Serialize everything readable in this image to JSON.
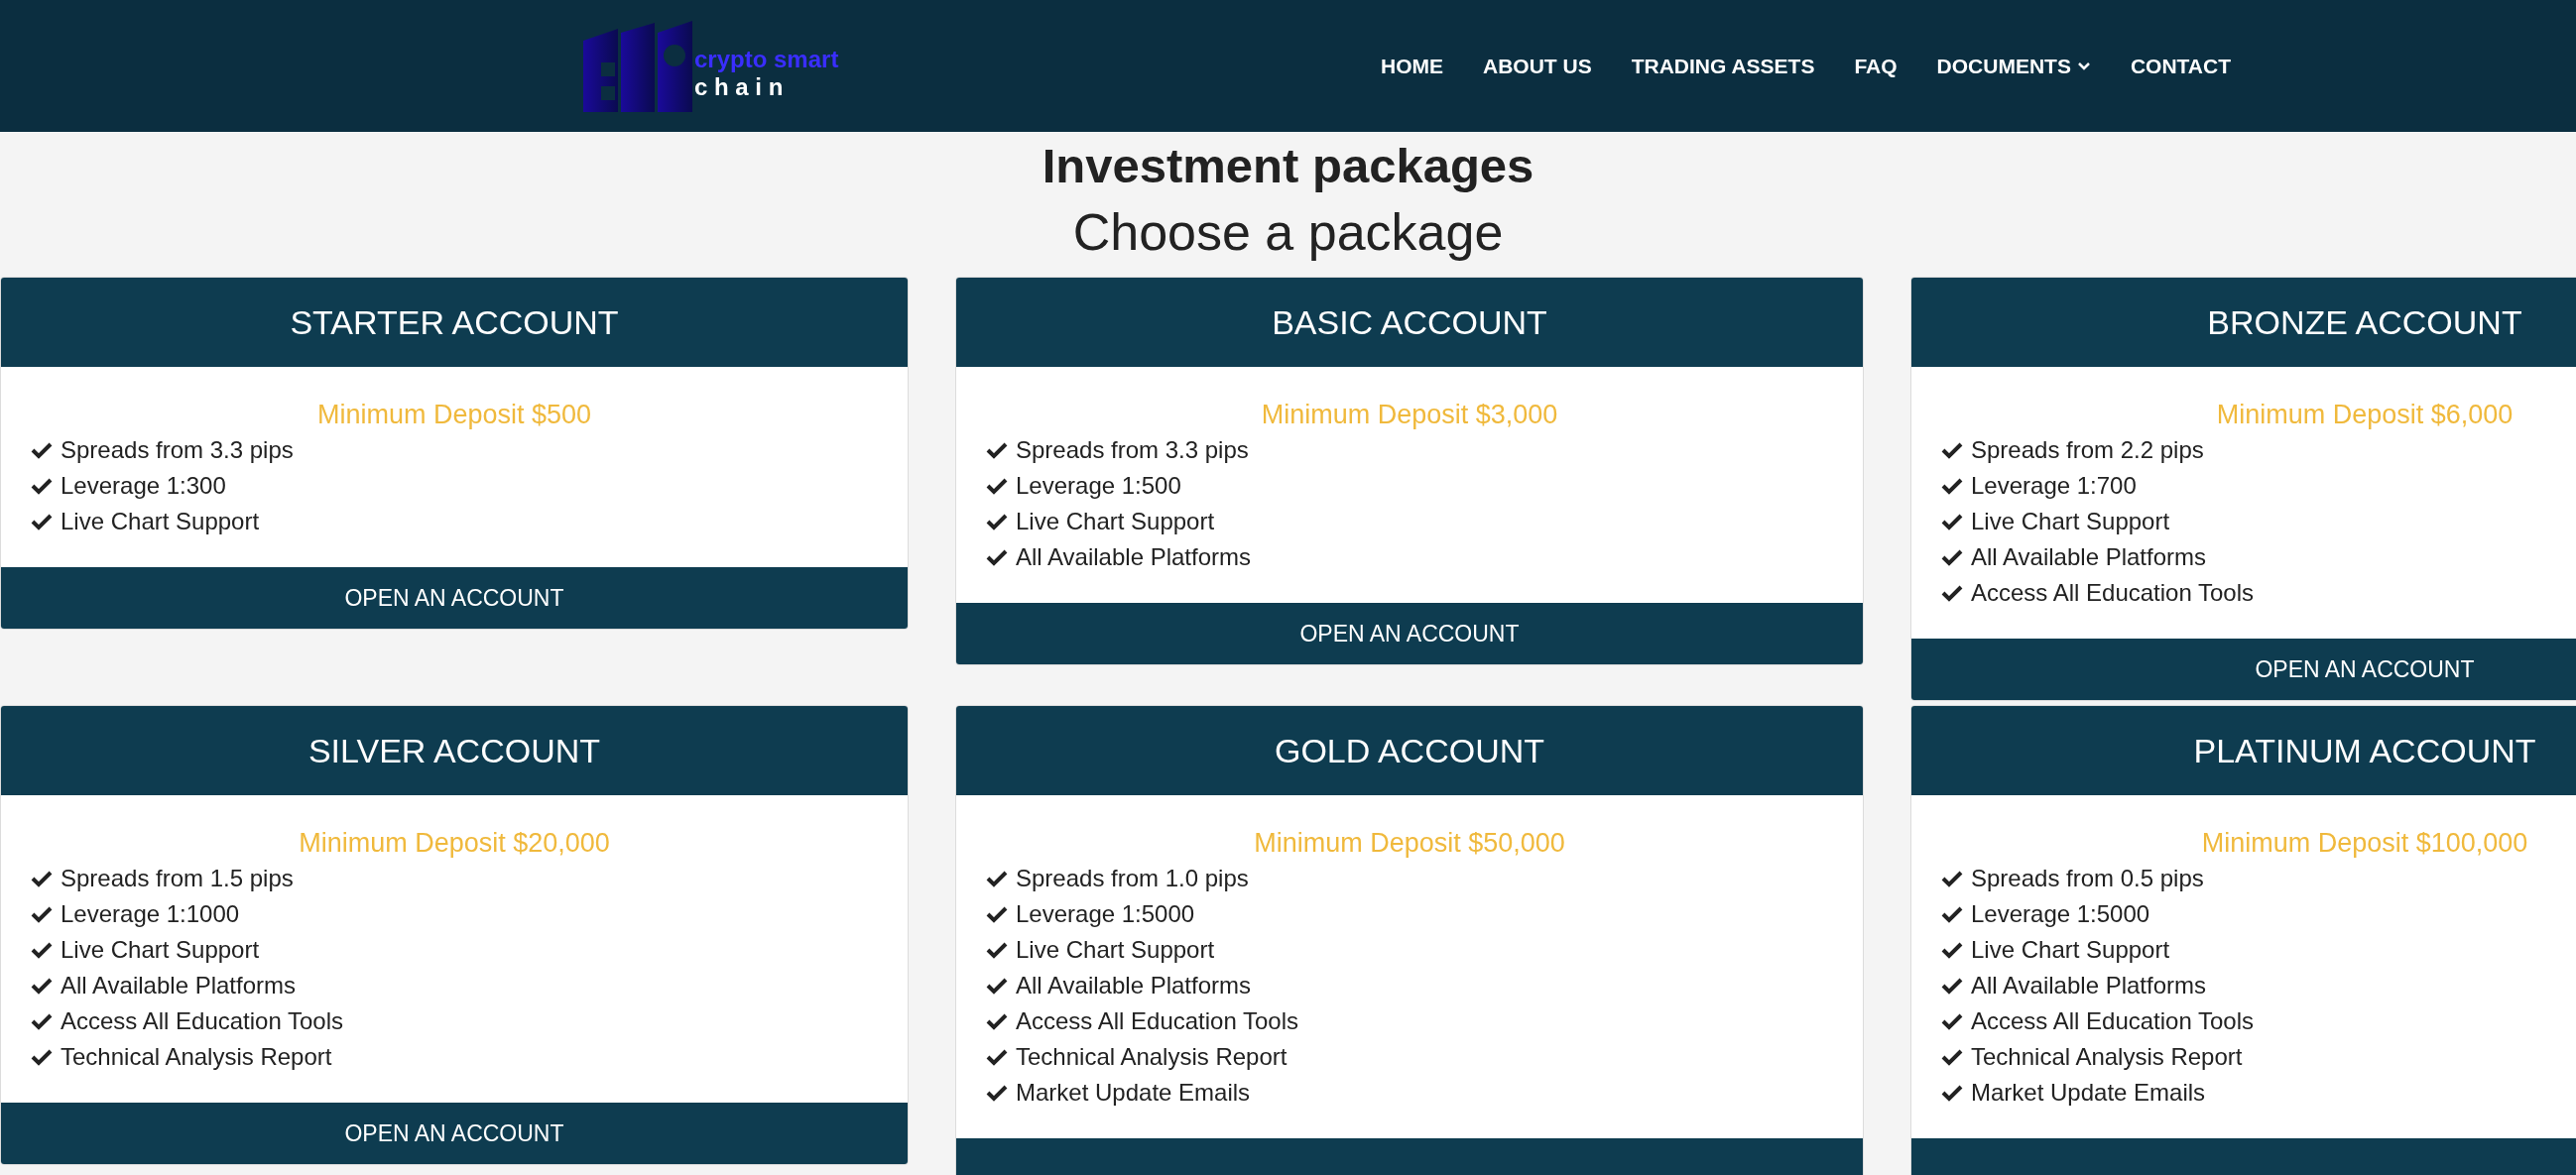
{
  "logo": {
    "line_1": "crypto smart",
    "line_2": "c h a i n"
  },
  "nav": [
    {
      "label": "HOME",
      "dropdown": false
    },
    {
      "label": "ABOUT US",
      "dropdown": false
    },
    {
      "label": "TRADING ASSETS",
      "dropdown": false
    },
    {
      "label": "FAQ",
      "dropdown": false
    },
    {
      "label": "DOCUMENTS",
      "dropdown": true
    },
    {
      "label": "CONTACT",
      "dropdown": false
    }
  ],
  "heading": "Investment packages",
  "subheading": "Choose a package",
  "packages": [
    {
      "title": "STARTER ACCOUNT",
      "deposit": "Minimum Deposit $500",
      "features": [
        "Spreads from 3.3 pips",
        "Leverage 1:300",
        "Live Chart Support"
      ],
      "button": "OPEN AN ACCOUNT"
    },
    {
      "title": "BASIC ACCOUNT",
      "deposit": "Minimum Deposit $3,000",
      "features": [
        "Spreads from 3.3 pips",
        "Leverage 1:500",
        "Live Chart Support",
        "All Available Platforms"
      ],
      "button": "OPEN AN ACCOUNT"
    },
    {
      "title": "BRONZE ACCOUNT",
      "deposit": "Minimum Deposit $6,000",
      "features": [
        "Spreads from 2.2 pips",
        "Leverage 1:700",
        "Live Chart Support",
        "All Available Platforms",
        "Access All Education Tools"
      ],
      "button": "OPEN AN ACCOUNT"
    },
    {
      "title": "SILVER ACCOUNT",
      "deposit": "Minimum Deposit $20,000",
      "features": [
        "Spreads from 1.5 pips",
        "Leverage 1:1000",
        "Live Chart Support",
        "All Available Platforms",
        "Access All Education Tools",
        "Technical Analysis Report"
      ],
      "button": "OPEN AN ACCOUNT"
    },
    {
      "title": "GOLD ACCOUNT",
      "deposit": "Minimum Deposit $50,000",
      "features": [
        "Spreads from 1.0 pips",
        "Leverage 1:5000",
        "Live Chart Support",
        "All Available Platforms",
        "Access All Education Tools",
        "Technical Analysis Report",
        "Market Update Emails"
      ]
    },
    {
      "title": "PLATINUM ACCOUNT",
      "deposit": "Minimum Deposit $100,000",
      "features": [
        "Spreads from 0.5 pips",
        "Leverage 1:5000",
        "Live Chart Support",
        "All Available Platforms",
        "Access All Education Tools",
        "Technical Analysis Report",
        "Market Update Emails"
      ]
    }
  ]
}
